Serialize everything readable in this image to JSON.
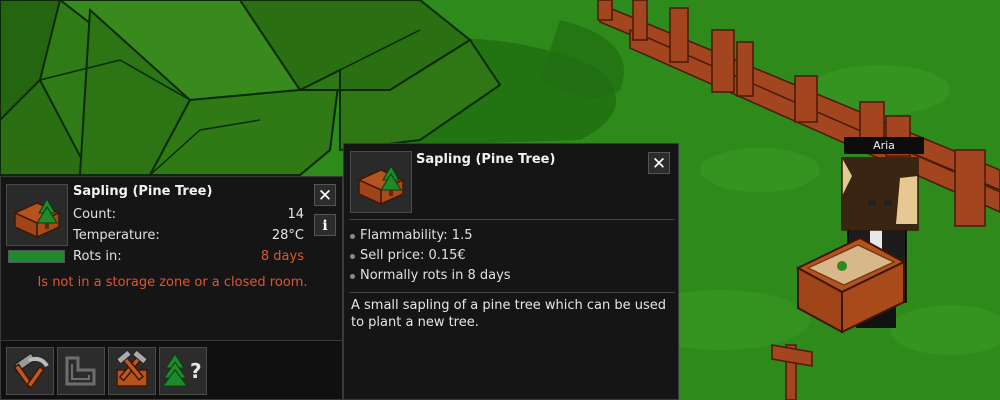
{
  "character": {
    "name": "Aria"
  },
  "info_panel": {
    "title": "Sapling (Pine Tree)",
    "count_label": "Count:",
    "count_value": "14",
    "temperature_label": "Temperature:",
    "temperature_value": "28°C",
    "rot_label": "Rots in:",
    "rot_value": "8 days",
    "rot_progress": 1.0,
    "warning": "Is not in a storage zone or a closed room.",
    "close_glyph": "✕",
    "info_glyph": "i"
  },
  "actions": [
    {
      "icon": "hammer-pickaxe-icon"
    },
    {
      "icon": "zone-outline-icon"
    },
    {
      "icon": "crossed-tools-crate-icon"
    },
    {
      "icon": "tree-question-icon"
    }
  ],
  "tooltip": {
    "title": "Sapling (Pine Tree)",
    "close_glyph": "✕",
    "properties": [
      "Flammability: 1.5",
      "Sell price: 0.15€",
      "Normally rots in 8 days"
    ],
    "description": "A small sapling of a pine tree which can be used to plant a new tree."
  },
  "colors": {
    "accent_red": "#e0552f",
    "progress_green": "#1e8a2e",
    "panel_bg": "#151515"
  }
}
